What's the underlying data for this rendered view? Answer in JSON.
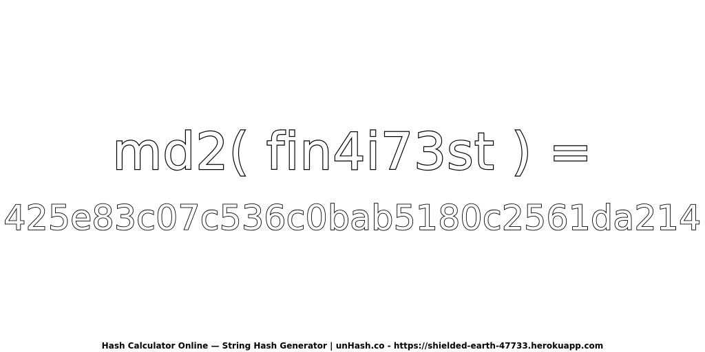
{
  "headline": "md2( fin4i73st ) =",
  "hash_value": "425e83c07c536c0bab5180c2561da214",
  "footer": "Hash Calculator Online — String Hash Generator | unHash.co - https://shielded-earth-47733.herokuapp.com",
  "colors": {
    "background": "#ffffff",
    "text_fill": "#ffffff",
    "text_outline": "#000000"
  }
}
